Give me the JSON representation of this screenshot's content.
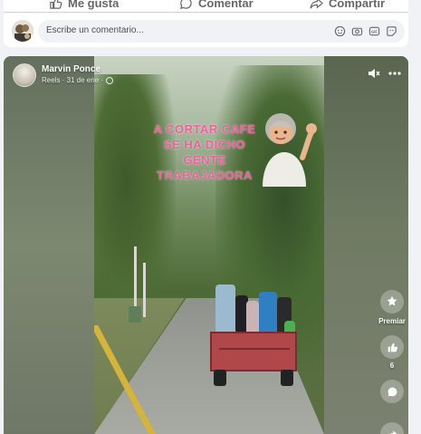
{
  "post_actions": {
    "like_label": "Me gusta",
    "comment_label": "Comentar",
    "share_label": "Compartir"
  },
  "comment_box": {
    "placeholder": "Escribe un comentario..."
  },
  "video_post": {
    "author": "Marvin Ponce",
    "meta": "Reels · 31 de ene ·",
    "overlay_text": "A CORTAR CAFE\nSE HA DICHO\nGENTE\nTRABAJADORA",
    "overlay_color": "#f0609c",
    "rail": {
      "premiar_label": "Premiar",
      "like_count": "6"
    }
  },
  "icons": [
    "thumbs-up-icon",
    "comment-icon",
    "share-icon",
    "emoji-icon",
    "camera-icon",
    "gif-icon",
    "sticker-icon",
    "globe-icon",
    "mute-icon",
    "more-icon",
    "award-icon",
    "comment-bubble-icon",
    "share-arrow-icon"
  ]
}
